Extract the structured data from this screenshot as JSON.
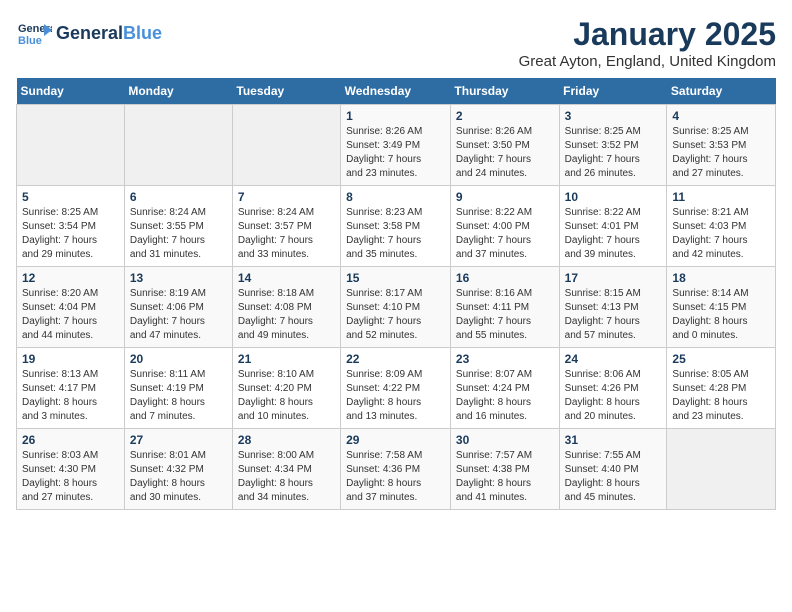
{
  "header": {
    "logo_line1": "General",
    "logo_line2": "Blue",
    "month": "January 2025",
    "location": "Great Ayton, England, United Kingdom"
  },
  "days_of_week": [
    "Sunday",
    "Monday",
    "Tuesday",
    "Wednesday",
    "Thursday",
    "Friday",
    "Saturday"
  ],
  "weeks": [
    [
      {
        "num": "",
        "info": ""
      },
      {
        "num": "",
        "info": ""
      },
      {
        "num": "",
        "info": ""
      },
      {
        "num": "1",
        "info": "Sunrise: 8:26 AM\nSunset: 3:49 PM\nDaylight: 7 hours\nand 23 minutes."
      },
      {
        "num": "2",
        "info": "Sunrise: 8:26 AM\nSunset: 3:50 PM\nDaylight: 7 hours\nand 24 minutes."
      },
      {
        "num": "3",
        "info": "Sunrise: 8:25 AM\nSunset: 3:52 PM\nDaylight: 7 hours\nand 26 minutes."
      },
      {
        "num": "4",
        "info": "Sunrise: 8:25 AM\nSunset: 3:53 PM\nDaylight: 7 hours\nand 27 minutes."
      }
    ],
    [
      {
        "num": "5",
        "info": "Sunrise: 8:25 AM\nSunset: 3:54 PM\nDaylight: 7 hours\nand 29 minutes."
      },
      {
        "num": "6",
        "info": "Sunrise: 8:24 AM\nSunset: 3:55 PM\nDaylight: 7 hours\nand 31 minutes."
      },
      {
        "num": "7",
        "info": "Sunrise: 8:24 AM\nSunset: 3:57 PM\nDaylight: 7 hours\nand 33 minutes."
      },
      {
        "num": "8",
        "info": "Sunrise: 8:23 AM\nSunset: 3:58 PM\nDaylight: 7 hours\nand 35 minutes."
      },
      {
        "num": "9",
        "info": "Sunrise: 8:22 AM\nSunset: 4:00 PM\nDaylight: 7 hours\nand 37 minutes."
      },
      {
        "num": "10",
        "info": "Sunrise: 8:22 AM\nSunset: 4:01 PM\nDaylight: 7 hours\nand 39 minutes."
      },
      {
        "num": "11",
        "info": "Sunrise: 8:21 AM\nSunset: 4:03 PM\nDaylight: 7 hours\nand 42 minutes."
      }
    ],
    [
      {
        "num": "12",
        "info": "Sunrise: 8:20 AM\nSunset: 4:04 PM\nDaylight: 7 hours\nand 44 minutes."
      },
      {
        "num": "13",
        "info": "Sunrise: 8:19 AM\nSunset: 4:06 PM\nDaylight: 7 hours\nand 47 minutes."
      },
      {
        "num": "14",
        "info": "Sunrise: 8:18 AM\nSunset: 4:08 PM\nDaylight: 7 hours\nand 49 minutes."
      },
      {
        "num": "15",
        "info": "Sunrise: 8:17 AM\nSunset: 4:10 PM\nDaylight: 7 hours\nand 52 minutes."
      },
      {
        "num": "16",
        "info": "Sunrise: 8:16 AM\nSunset: 4:11 PM\nDaylight: 7 hours\nand 55 minutes."
      },
      {
        "num": "17",
        "info": "Sunrise: 8:15 AM\nSunset: 4:13 PM\nDaylight: 7 hours\nand 57 minutes."
      },
      {
        "num": "18",
        "info": "Sunrise: 8:14 AM\nSunset: 4:15 PM\nDaylight: 8 hours\nand 0 minutes."
      }
    ],
    [
      {
        "num": "19",
        "info": "Sunrise: 8:13 AM\nSunset: 4:17 PM\nDaylight: 8 hours\nand 3 minutes."
      },
      {
        "num": "20",
        "info": "Sunrise: 8:11 AM\nSunset: 4:19 PM\nDaylight: 8 hours\nand 7 minutes."
      },
      {
        "num": "21",
        "info": "Sunrise: 8:10 AM\nSunset: 4:20 PM\nDaylight: 8 hours\nand 10 minutes."
      },
      {
        "num": "22",
        "info": "Sunrise: 8:09 AM\nSunset: 4:22 PM\nDaylight: 8 hours\nand 13 minutes."
      },
      {
        "num": "23",
        "info": "Sunrise: 8:07 AM\nSunset: 4:24 PM\nDaylight: 8 hours\nand 16 minutes."
      },
      {
        "num": "24",
        "info": "Sunrise: 8:06 AM\nSunset: 4:26 PM\nDaylight: 8 hours\nand 20 minutes."
      },
      {
        "num": "25",
        "info": "Sunrise: 8:05 AM\nSunset: 4:28 PM\nDaylight: 8 hours\nand 23 minutes."
      }
    ],
    [
      {
        "num": "26",
        "info": "Sunrise: 8:03 AM\nSunset: 4:30 PM\nDaylight: 8 hours\nand 27 minutes."
      },
      {
        "num": "27",
        "info": "Sunrise: 8:01 AM\nSunset: 4:32 PM\nDaylight: 8 hours\nand 30 minutes."
      },
      {
        "num": "28",
        "info": "Sunrise: 8:00 AM\nSunset: 4:34 PM\nDaylight: 8 hours\nand 34 minutes."
      },
      {
        "num": "29",
        "info": "Sunrise: 7:58 AM\nSunset: 4:36 PM\nDaylight: 8 hours\nand 37 minutes."
      },
      {
        "num": "30",
        "info": "Sunrise: 7:57 AM\nSunset: 4:38 PM\nDaylight: 8 hours\nand 41 minutes."
      },
      {
        "num": "31",
        "info": "Sunrise: 7:55 AM\nSunset: 4:40 PM\nDaylight: 8 hours\nand 45 minutes."
      },
      {
        "num": "",
        "info": ""
      }
    ]
  ]
}
